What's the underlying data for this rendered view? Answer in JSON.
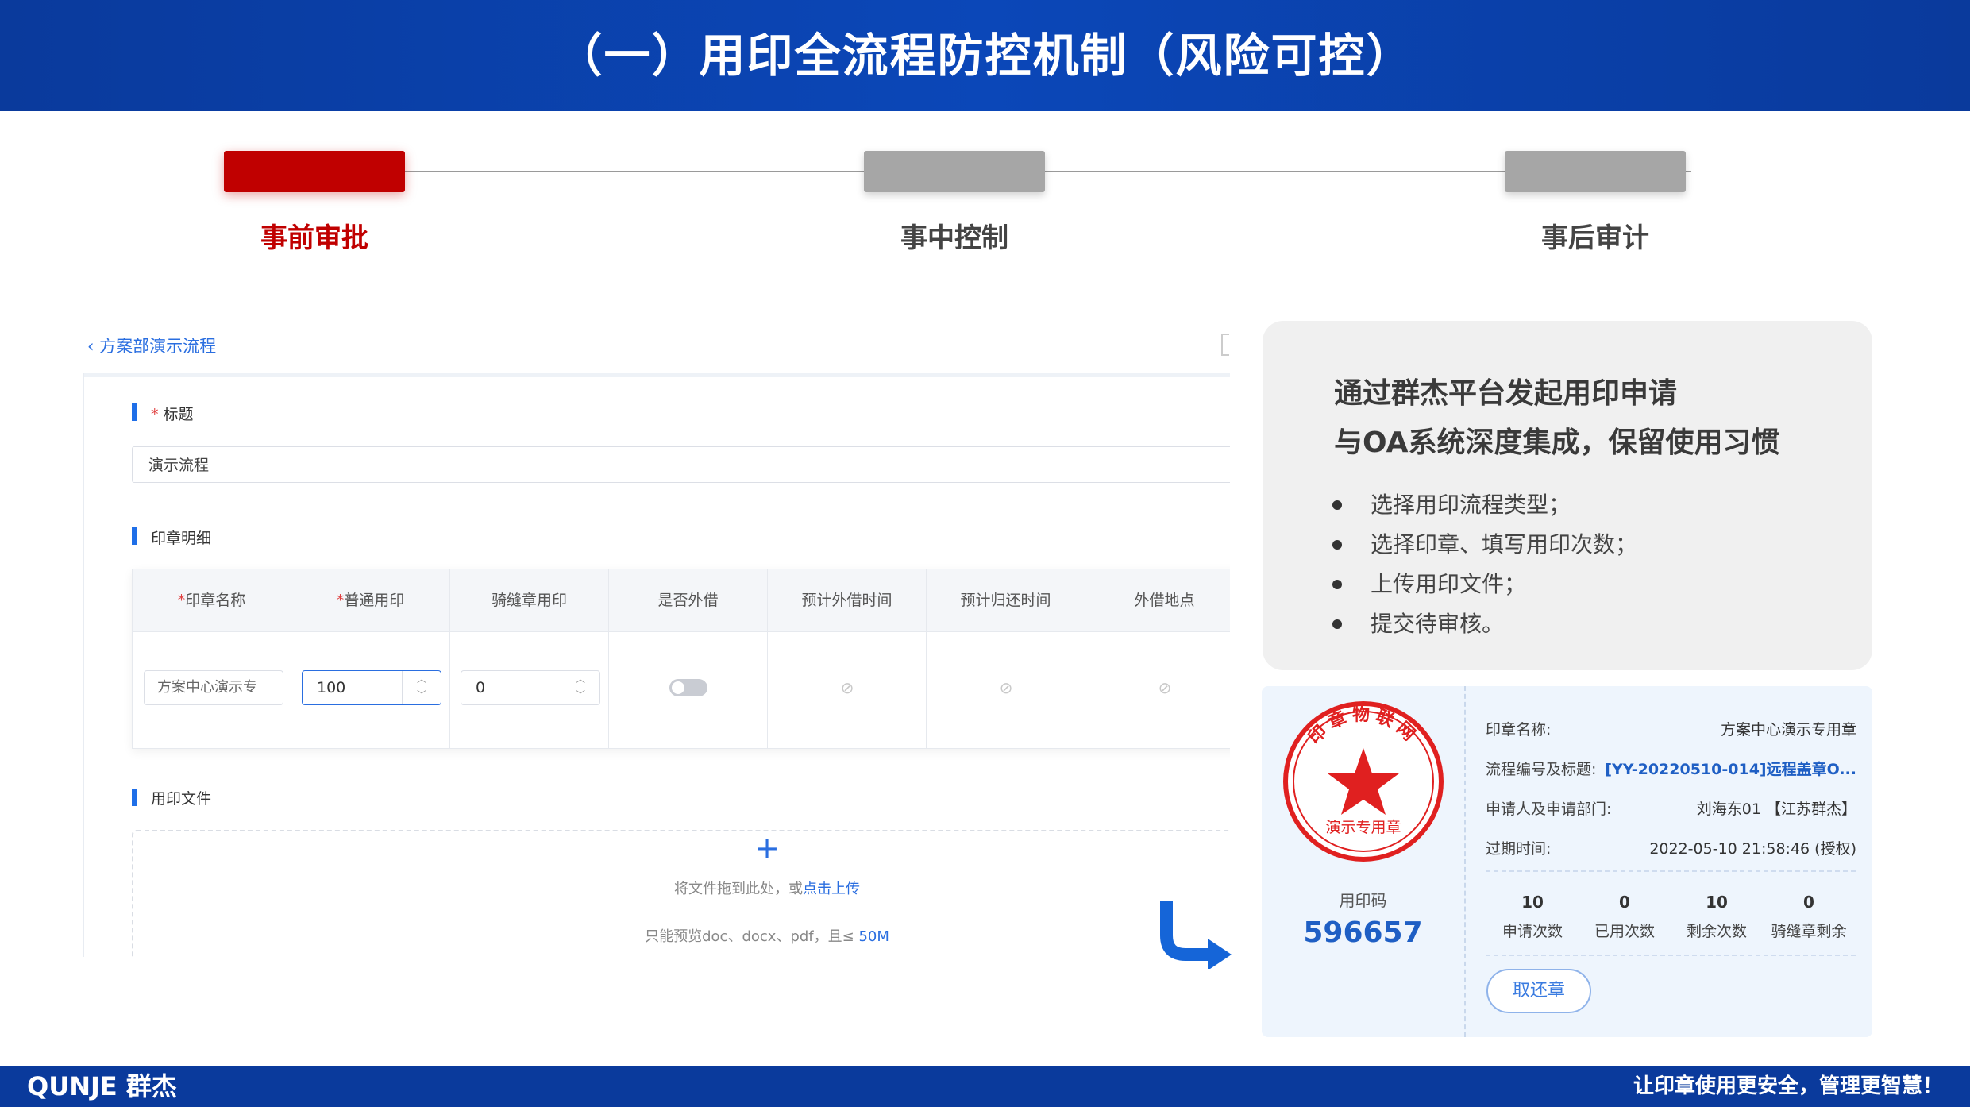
{
  "header": {
    "title": "（一）用印全流程防控机制（风险可控）"
  },
  "steps": [
    {
      "label": "事前审批",
      "active": true
    },
    {
      "label": "事中控制",
      "active": false
    },
    {
      "label": "事后审计",
      "active": false
    }
  ],
  "colors": {
    "brand_blue": "#0a3a9c",
    "active_red": "#c00000",
    "inactive_gray": "#a6a6a6",
    "accent_blue": "#1f6fe8"
  },
  "form": {
    "breadcrumb": "方案部演示流程",
    "title_section": {
      "required": "*",
      "label": "标题",
      "value": "演示流程"
    },
    "seal_section": {
      "label": "印章明细"
    },
    "table": {
      "headers": [
        {
          "required": "*",
          "label": "印章名称"
        },
        {
          "required": "*",
          "label": "普通用印"
        },
        {
          "required": "",
          "label": "骑缝章用印"
        },
        {
          "required": "",
          "label": "是否外借"
        },
        {
          "required": "",
          "label": "预计外借时间"
        },
        {
          "required": "",
          "label": "预计归还时间"
        },
        {
          "required": "",
          "label": "外借地点"
        }
      ],
      "row": {
        "seal_name": "方案中心演示专",
        "normal_count": "100",
        "seam_count": "0",
        "lend": false
      }
    },
    "file_section": {
      "label": "用印文件",
      "plus": "+",
      "drop_text": "将文件拖到此处，或",
      "upload_link": "点击上传",
      "limit_text": "只能预览doc、docx、pdf，且≤ ",
      "limit_size": "50M"
    }
  },
  "info": {
    "heading1": "通过群杰平台发起用印申请",
    "heading2": "与OA系统深度集成，保留使用习惯",
    "bullets": [
      "选择用印流程类型；",
      "选择印章、填写用印次数；",
      "上传用印文件；",
      "提交待审核。"
    ]
  },
  "seal_card": {
    "stamp": {
      "arc_text": "印章物联网",
      "bottom_text": "演示专用章"
    },
    "code_label": "用印码",
    "code_value": "596657",
    "fields": [
      {
        "key": "印章名称:",
        "value": "方案中心演示专用章",
        "highlight": false
      },
      {
        "key": "流程编号及标题:",
        "value": "[YY-20220510-014]远程盖章O...",
        "highlight": true
      },
      {
        "key": "申请人及申请部门:",
        "value": "刘海东01 【江苏群杰】",
        "highlight": false
      },
      {
        "key": "过期时间:",
        "value": "2022-05-10 21:58:46 (授权)",
        "highlight": false
      }
    ],
    "stats": [
      {
        "num": "10",
        "label": "申请次数"
      },
      {
        "num": "0",
        "label": "已用次数"
      },
      {
        "num": "10",
        "label": "剩余次数"
      },
      {
        "num": "0",
        "label": "骑缝章剩余"
      }
    ],
    "return_button": "取还章"
  },
  "footer": {
    "brand": "QUNJE 群杰",
    "slogan": "让印章使用更安全，管理更智慧！"
  }
}
